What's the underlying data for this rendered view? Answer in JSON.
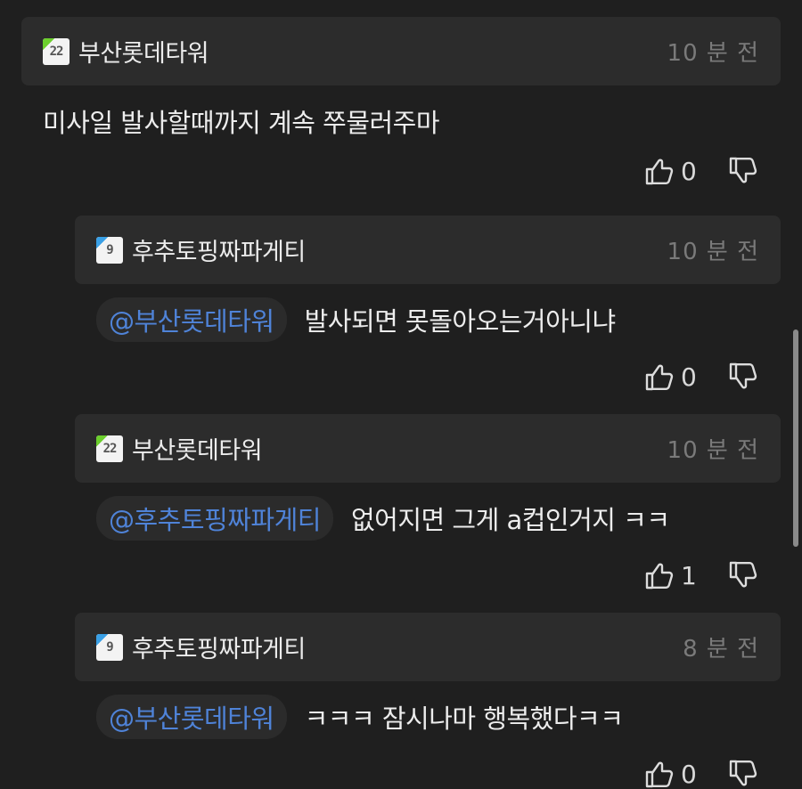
{
  "colors": {
    "background": "#1f1f1f",
    "header_bg": "#2c2c2c",
    "mention": "#4f83d8",
    "badge_green": "#6ccf2d",
    "badge_blue": "#3aa0e6"
  },
  "comments": [
    {
      "level": "22",
      "username": "부산롯데타워",
      "time": "10 분 전",
      "mention": "",
      "text": "미사일 발사할때까지 계속 쭈물러주마",
      "likes": "0"
    },
    {
      "level": "9",
      "username": "후추토핑짜파게티",
      "time": "10 분 전",
      "mention": "@부산롯데타워",
      "text": "발사되면 못돌아오는거아니냐",
      "likes": "0"
    },
    {
      "level": "22",
      "username": "부산롯데타워",
      "time": "10 분 전",
      "mention": "@후추토핑짜파게티",
      "text": "없어지면 그게 a컵인거지 ㅋㅋ",
      "likes": "1"
    },
    {
      "level": "9",
      "username": "후추토핑짜파게티",
      "time": "8 분 전",
      "mention": "@부산롯데타워",
      "text": "ㅋㅋㅋ 잠시나마 행복했다ㅋㅋ",
      "likes": "0"
    }
  ]
}
